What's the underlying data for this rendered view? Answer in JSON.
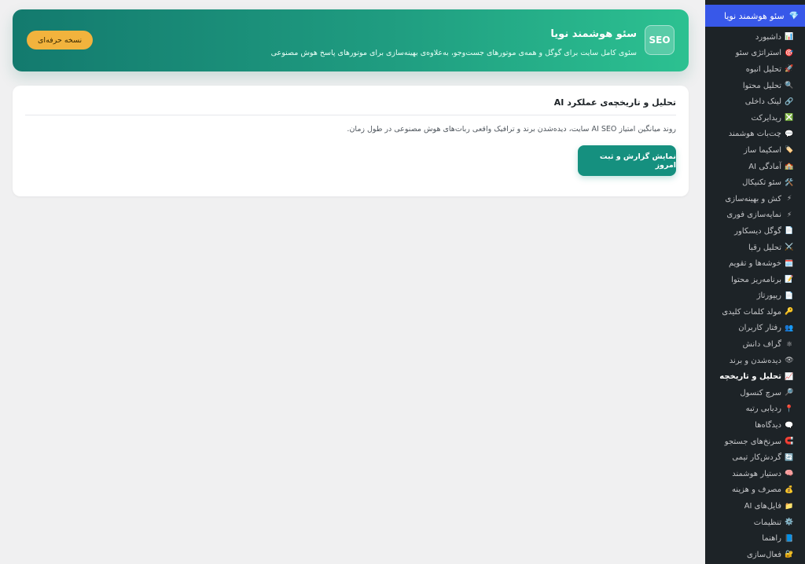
{
  "sidebar": {
    "parent_label": "سئو هوشمند نویا",
    "parent_icon": "💎",
    "items": [
      {
        "icon": "📊",
        "label": "داشبورد"
      },
      {
        "icon": "🎯",
        "label": "استراتژی سئو"
      },
      {
        "icon": "🚀",
        "label": "تحلیل انبوه"
      },
      {
        "icon": "🔍",
        "label": "تحلیل محتوا"
      },
      {
        "icon": "🔗",
        "label": "لینک داخلی"
      },
      {
        "icon": "❎",
        "label": "ریدایرکت"
      },
      {
        "icon": "💬",
        "label": "چت‌بات هوشمند"
      },
      {
        "icon": "🏷️",
        "label": "اسکیما ساز"
      },
      {
        "icon": "🏫",
        "label": "آمادگی AI"
      },
      {
        "icon": "🛠️",
        "label": "سئو تکنیکال"
      },
      {
        "icon": "⚡",
        "label": "کش و بهینه‌سازی"
      },
      {
        "icon": "⚡",
        "label": "نمایه‌سازی فوری"
      },
      {
        "icon": "📄",
        "label": "گوگل دیسکاور"
      },
      {
        "icon": "⚔️",
        "label": "تحلیل رقبا"
      },
      {
        "icon": "🗓️",
        "label": "خوشه‌ها و تقویم"
      },
      {
        "icon": "📝",
        "label": "برنامه‌ریز محتوا"
      },
      {
        "icon": "📄",
        "label": "ریپورتاژ"
      },
      {
        "icon": "🔑",
        "label": "مولد کلمات کلیدی"
      },
      {
        "icon": "👥",
        "label": "رفتار کاربران"
      },
      {
        "icon": "⚛",
        "label": "گراف دانش"
      },
      {
        "icon": "👁",
        "label": "دیده‌شدن و برند"
      },
      {
        "icon": "📈",
        "label": "تحلیل و تاریخچه",
        "current": true
      },
      {
        "icon": "🔎",
        "label": "سرچ کنسول"
      },
      {
        "icon": "📍",
        "label": "ردیابی رتبه"
      },
      {
        "icon": "🗨️",
        "label": "دیدگاه‌ها"
      },
      {
        "icon": "🧲",
        "label": "سرنخ‌های جستجو"
      },
      {
        "icon": "🔄",
        "label": "گردش‌کار تیمی"
      },
      {
        "icon": "🧠",
        "label": "دستیار هوشمند"
      },
      {
        "icon": "💰",
        "label": "مصرف و هزینه"
      },
      {
        "icon": "📁",
        "label": "فایل‌های AI"
      },
      {
        "icon": "⚙️",
        "label": "تنظیمات"
      },
      {
        "icon": "📘",
        "label": "راهنما"
      },
      {
        "icon": "🔐",
        "label": "فعال‌سازی"
      }
    ]
  },
  "hero": {
    "logo_text": "SEO",
    "title": "سئو هوشمند نویا",
    "subtitle": "سئوی کامل سایت برای گوگل و همه‌ی موتورهای جست‌وجو، به‌علاوه‌ی بهینه‌سازی برای موتورهای پاسخ هوش مصنوعی",
    "pro_button": "نسخه حرفه‌ای"
  },
  "card": {
    "title": "تحلیل و تاریخچه‌ی عملکرد AI",
    "description": "روند میانگین امتیاز AI SEO سایت، دیده‌شدن برند و ترافیک واقعی ربات‌های هوش مصنوعی در طول زمان.",
    "button": "نمایش گزارش و ثبت امروز"
  }
}
